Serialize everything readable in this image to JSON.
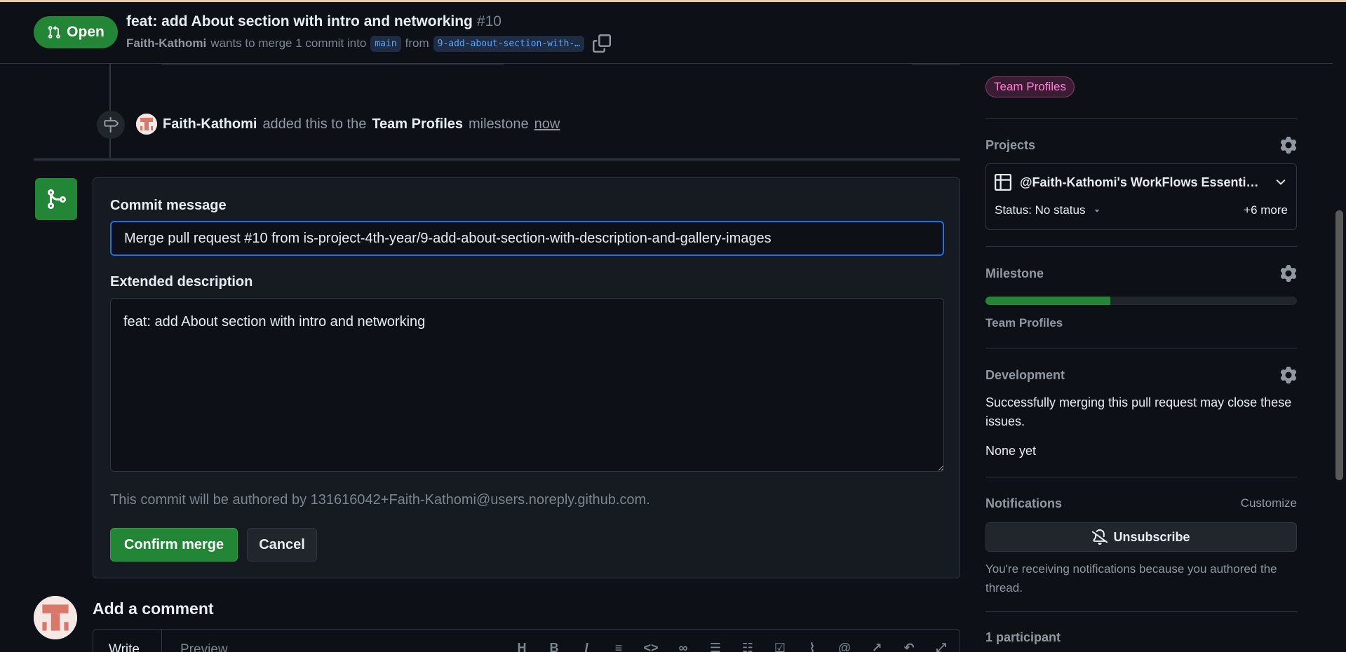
{
  "header": {
    "state_label": "Open",
    "title": "feat: add About section with intro and networking",
    "number": "#10",
    "author": "Faith-Kathomi",
    "merge_text": "wants to merge 1 commit into",
    "base_branch": "main",
    "from_text": "from",
    "head_branch": "9-add-about-section-with-…"
  },
  "timeline": {
    "event_actor": "Faith-Kathomi",
    "event_text_1": "added this to the",
    "milestone_name": "Team Profiles",
    "event_text_2": "milestone",
    "event_time": "now"
  },
  "merge_form": {
    "commit_message_label": "Commit message",
    "commit_message_value": "Merge pull request #10 from is-project-4th-year/9-add-about-section-with-description-and-gallery-images",
    "extended_description_label": "Extended description",
    "extended_description_value": "feat: add About section with intro and networking",
    "author_note": "This commit will be authored by 131616042+Faith-Kathomi@users.noreply.github.com.",
    "confirm_label": "Confirm merge",
    "cancel_label": "Cancel"
  },
  "comment": {
    "title": "Add a comment",
    "tab_write": "Write",
    "tab_preview": "Preview",
    "toolbar": [
      "H",
      "B",
      "I"
    ]
  },
  "sidebar": {
    "label_pill": "Team Profiles",
    "projects_heading": "Projects",
    "project_title": "@Faith-Kathomi's WorkFlows Essenti…",
    "project_status": "Status: No status",
    "project_more": "+6 more",
    "milestone_heading": "Milestone",
    "milestone_progress": 0.4,
    "milestone_name": "Team Profiles",
    "development_heading": "Development",
    "development_text": "Successfully merging this pull request may close these issues.",
    "development_none": "None yet",
    "notifications_heading": "Notifications",
    "customize_label": "Customize",
    "unsubscribe_label": "Unsubscribe",
    "notifications_reason": "You're receiving notifications because you authored the thread.",
    "participants": "1 participant"
  },
  "colors": {
    "accent_green": "#238636",
    "focus_blue": "#1f6feb",
    "label_pink": "#ff7fd6"
  }
}
